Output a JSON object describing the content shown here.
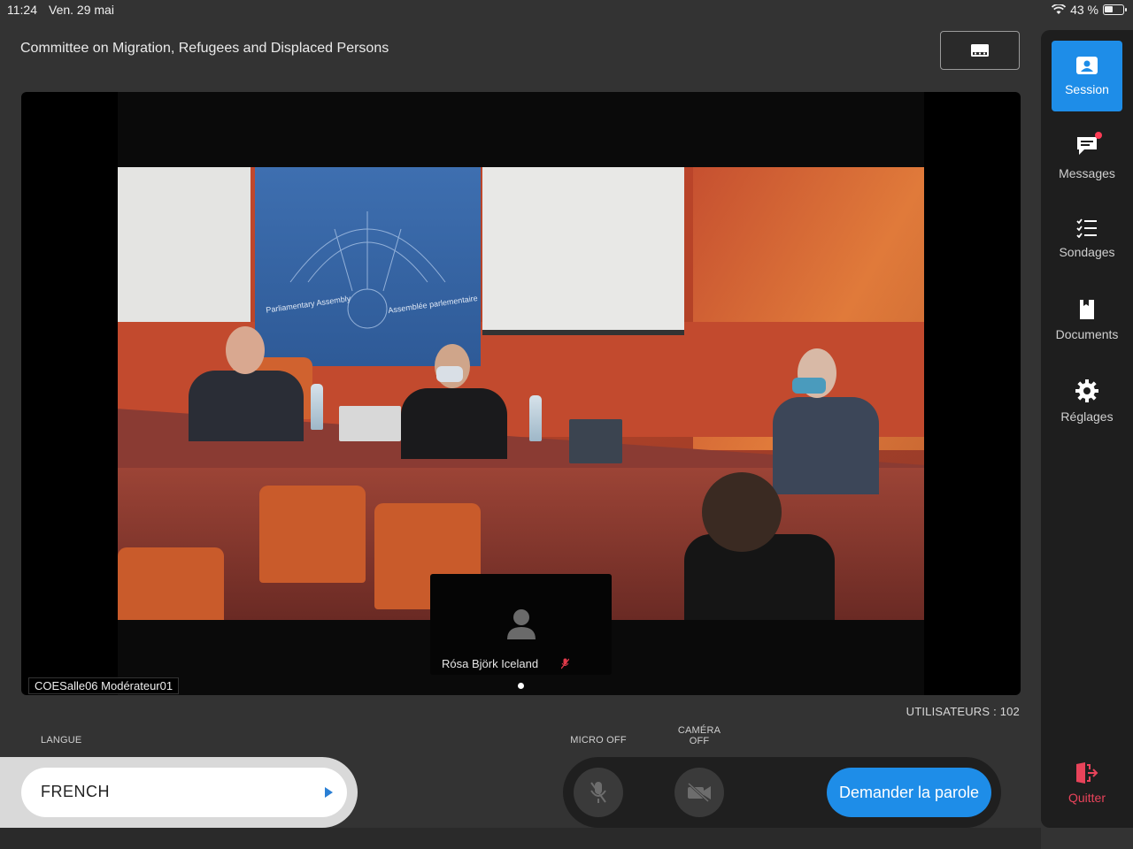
{
  "status_bar": {
    "time": "11:24",
    "date": "Ven. 29 mai",
    "battery": "43 %",
    "battery_level": 0.43
  },
  "header": {
    "title": "Committee on Migration, Refugees and Displaced Persons",
    "layout_button_icon": "layout-toggle-icon"
  },
  "video": {
    "host_label": "COESalle06 Modérateur01",
    "banner_left": "Parliamentary Assembly",
    "banner_right": "Assemblée parlementaire",
    "participant": {
      "name": "Rósa Björk Iceland",
      "mic_icon": "mic-muted-icon"
    },
    "page_indicator": {
      "count": 1,
      "active": 1
    }
  },
  "users_count": "UTILISATEURS : 102",
  "language": {
    "label": "LANGUE",
    "value": "FRENCH"
  },
  "controls": {
    "micro_label": "MICRO OFF",
    "camera_label": "CAMÉRA OFF",
    "speak_label": "Demander la parole"
  },
  "sidebar": {
    "items": [
      {
        "label": "Session",
        "icon": "session-icon",
        "active": true
      },
      {
        "label": "Messages",
        "icon": "messages-icon",
        "badge": true
      },
      {
        "label": "Sondages",
        "icon": "polls-icon"
      },
      {
        "label": "Documents",
        "icon": "documents-icon"
      },
      {
        "label": "Réglages",
        "icon": "settings-icon"
      }
    ],
    "quit_label": "Quitter"
  },
  "colors": {
    "accent": "#1e8de8",
    "quit": "#e8435a",
    "background": "#333333"
  }
}
